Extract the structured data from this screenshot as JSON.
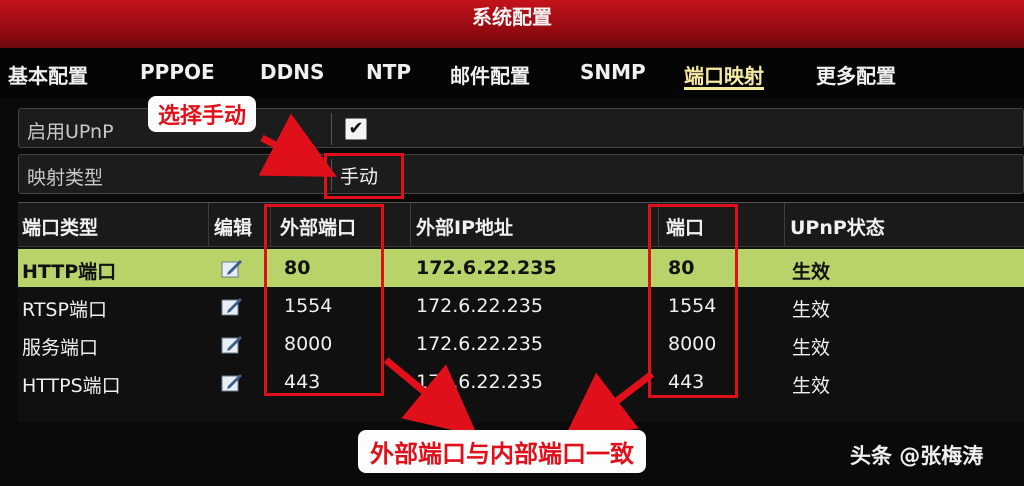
{
  "window": {
    "title": "系统配置"
  },
  "tabs": [
    {
      "label": "基本配置",
      "active": false
    },
    {
      "label": "PPPOE",
      "active": false
    },
    {
      "label": "DDNS",
      "active": false
    },
    {
      "label": "NTP",
      "active": false
    },
    {
      "label": "邮件配置",
      "active": false
    },
    {
      "label": "SNMP",
      "active": false
    },
    {
      "label": "端口映射",
      "active": true
    },
    {
      "label": "更多配置",
      "active": false
    }
  ],
  "form": {
    "upnp_label": "启用UPnP",
    "upnp_checked": true,
    "upnp_check_glyph": "✔",
    "mapping_type_label": "映射类型",
    "mapping_type_value": "手动"
  },
  "table": {
    "headers": [
      "端口类型",
      "编辑",
      "外部端口",
      "外部IP地址",
      "端口",
      "UPnP状态"
    ],
    "rows": [
      {
        "type": "HTTP端口",
        "external_port": "80",
        "external_ip": "172.6.22.235",
        "port": "80",
        "status": "生效",
        "selected": true
      },
      {
        "type": "RTSP端口",
        "external_port": "1554",
        "external_ip": "172.6.22.235",
        "port": "1554",
        "status": "生效",
        "selected": false
      },
      {
        "type": "服务端口",
        "external_port": "8000",
        "external_ip": "172.6.22.235",
        "port": "8000",
        "status": "生效",
        "selected": false
      },
      {
        "type": "HTTPS端口",
        "external_port": "443",
        "external_ip": "172.6.22.235",
        "port": "443",
        "status": "生效",
        "selected": false
      }
    ]
  },
  "annotations": {
    "select_manual": "选择手动",
    "ports_match": "外部端口与内部端口一致",
    "color": "#e0101a"
  },
  "watermark": "头条 @张梅涛",
  "colors": {
    "title_bar": "#b0101a",
    "selected_row": "#b7d36a",
    "active_tab": "#f5e9a0"
  }
}
